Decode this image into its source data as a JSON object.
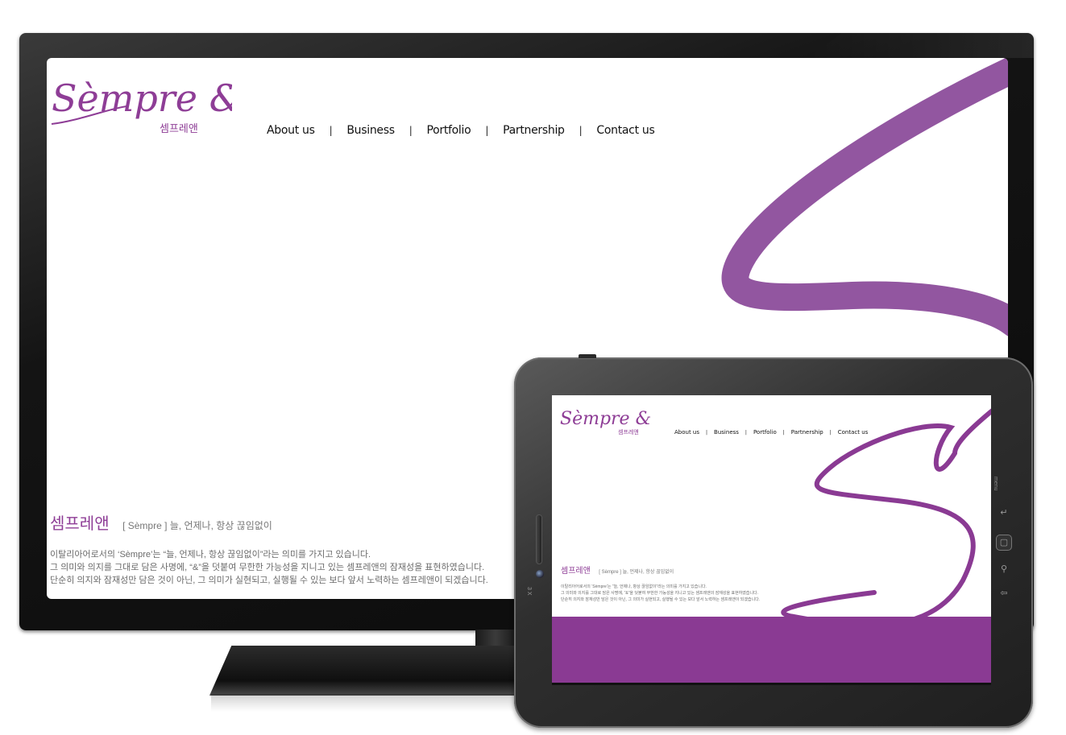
{
  "site": {
    "logo_text": "Sèmpre &",
    "logo_sub": "셈프레앤",
    "nav": [
      "About us",
      "Business",
      "Portfolio",
      "Partnership",
      "Contact us"
    ],
    "intro": {
      "brand": "셈프레앤",
      "subtitle": "[ Sèmpre ] 늘, 언제나, 항상 끊임없이",
      "lines": [
        "이탈리아어로서의 ‘Sèmpre’는 “늘, 언제나, 항상 끊임없이”라는 의미를 가지고 있습니다.",
        "그 의미와 의지를 그대로 담은 사명에, “&”을 덧붙여 무한한 가능성을 지니고 있는 셈프레앤의 잠재성을 표현하였습니다.",
        "단순히 의지와 잠재성만 담은 것이 아닌, 그 의미가 실현되고, 실행될 수 있는 보다 앞서 노력하는 셈프레앤이 되겠습니다."
      ]
    }
  },
  "tablet": {
    "menu_label": "menu",
    "camera_label": "3 X",
    "buttons": [
      "back-icon",
      "home-icon",
      "search-icon",
      "return-icon"
    ]
  },
  "colors": {
    "brand_purple": "#8e3d96",
    "swirl_purple": "#9256a0",
    "footer_purple": "#8a3a93"
  }
}
